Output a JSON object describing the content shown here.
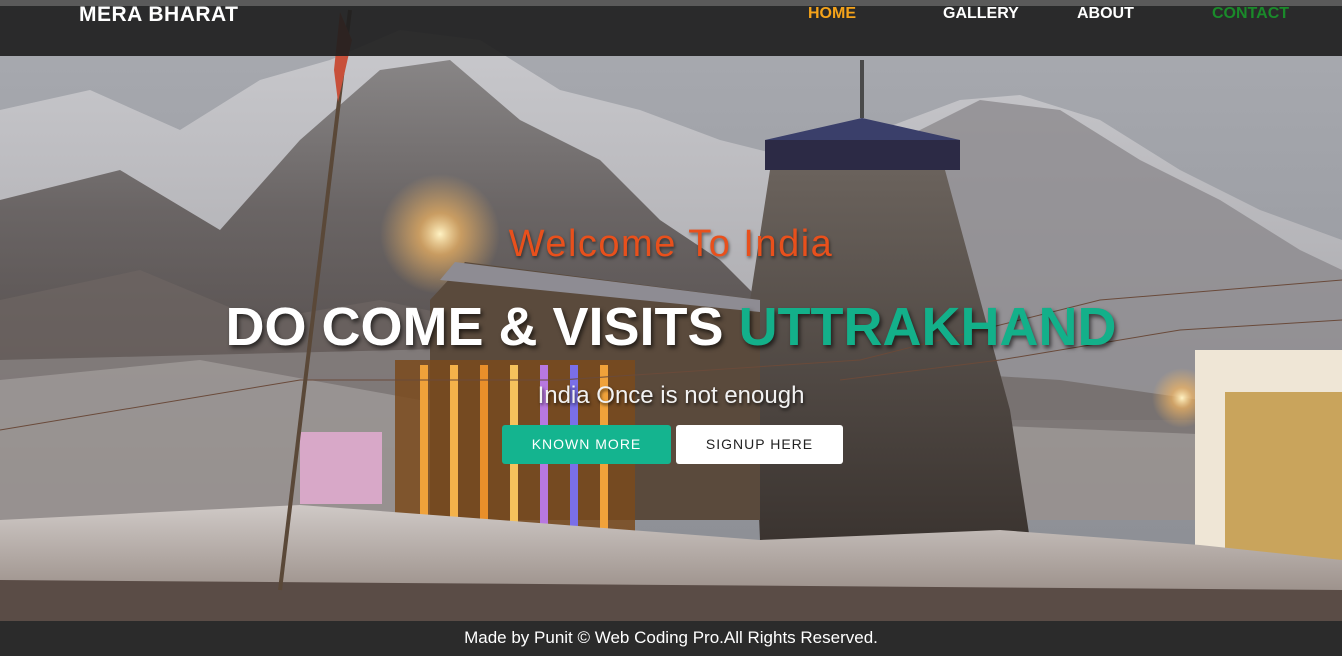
{
  "nav": {
    "brand": "MERA BHARAT",
    "links": [
      {
        "label": "HOME",
        "color": "#f5a31a"
      },
      {
        "label": "GALLERY",
        "color": "#ffffff"
      },
      {
        "label": "ABOUT",
        "color": "#ffffff"
      },
      {
        "label": "CONTACT",
        "color": "#1a8a2a"
      }
    ]
  },
  "hero": {
    "welcome": "Welcome To India",
    "headline_main": "DO COME & VISITS",
    "headline_accent": "UTTRAKHAND",
    "tagline": "India Once is not enough",
    "primary_button": "KNOWN MORE",
    "secondary_button": "SIGNUP HERE",
    "colors": {
      "welcome": "#e8501c",
      "accent": "#13b08a",
      "primary_button": "#14b48f"
    }
  },
  "footer": {
    "text": "Made by Punit © Web Coding Pro.All Rights Reserved."
  }
}
